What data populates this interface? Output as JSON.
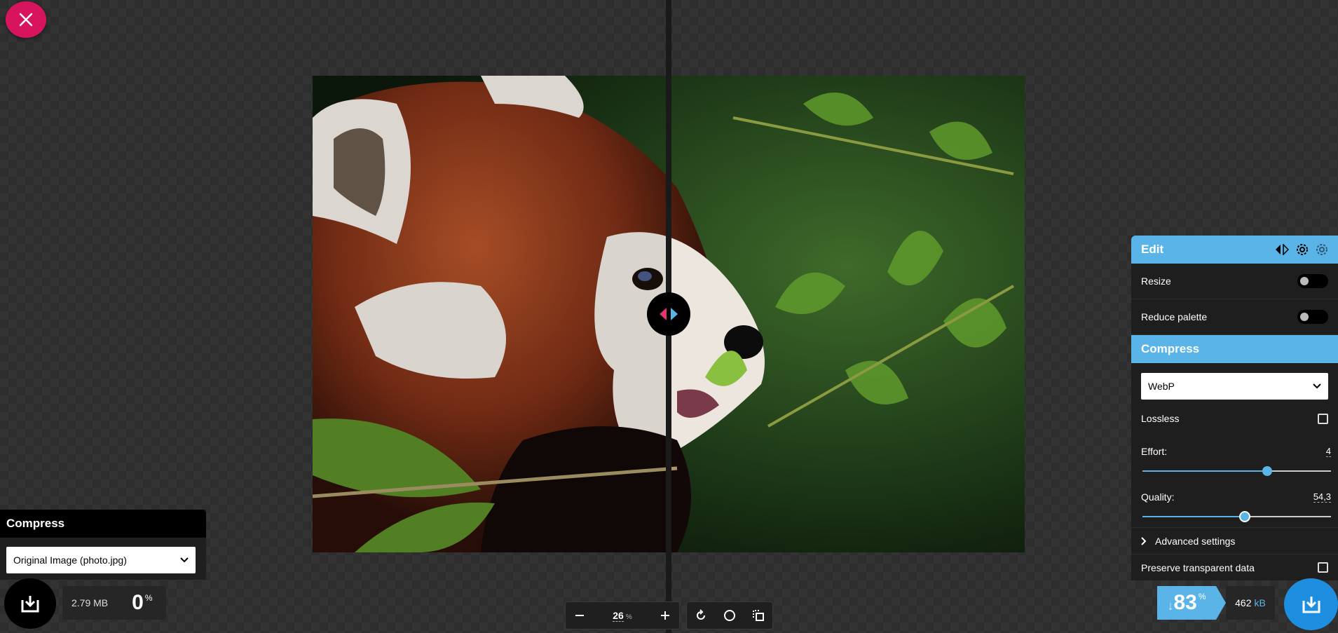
{
  "app": {
    "accent": "#5ab4e8",
    "close_color": "#d9145e"
  },
  "close_button": {
    "icon": "close-icon"
  },
  "left_panel": {
    "title": "Compress",
    "source_select": "Original Image (photo.jpg)",
    "file_size": "2.79 MB",
    "reduction_value": "0",
    "reduction_symbol": "%"
  },
  "zoom": {
    "value": "26",
    "unit": "%"
  },
  "toolbar": {
    "icons": [
      "rotate-icon",
      "background-circle-icon",
      "view-mode-icon"
    ]
  },
  "edit_panel": {
    "title": "Edit",
    "resize_label": "Resize",
    "reduce_palette_label": "Reduce palette"
  },
  "compress_panel": {
    "title": "Compress",
    "format": "WebP",
    "lossless_label": "Lossless",
    "effort_label": "Effort:",
    "effort_value": "4",
    "effort_fraction": 0.66,
    "quality_label": "Quality:",
    "quality_value": "54,3",
    "quality_fraction": 0.543,
    "advanced_label": "Advanced settings",
    "preserve_label": "Preserve transparent data"
  },
  "result": {
    "arrow": "↓",
    "reduction_value": "83",
    "reduction_symbol": "%",
    "size_value": "462",
    "size_unit": "kB"
  }
}
